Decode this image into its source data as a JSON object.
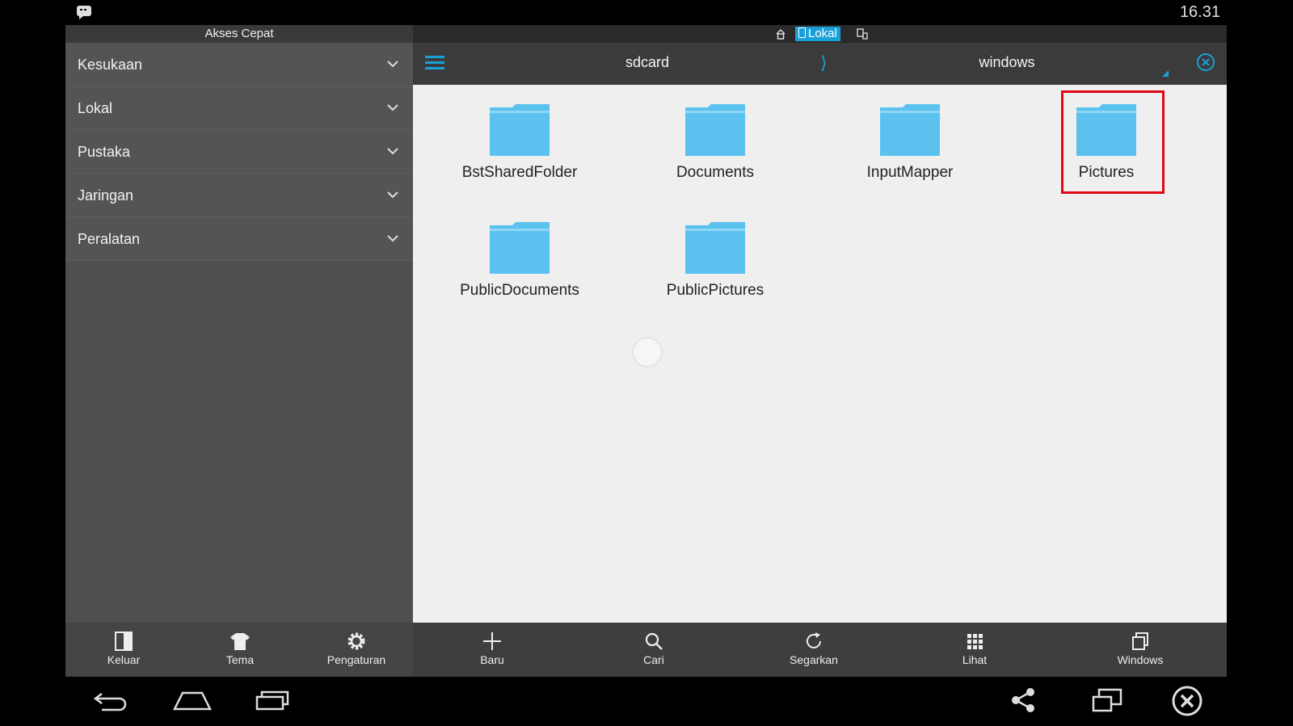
{
  "status_bar": {
    "time": "16.31",
    "notification_icon": "chat-notification-icon"
  },
  "drawer": {
    "title": "Akses Cepat",
    "items": [
      {
        "label": "Kesukaan"
      },
      {
        "label": "Lokal"
      },
      {
        "label": "Pustaka"
      },
      {
        "label": "Jaringan"
      },
      {
        "label": "Peralatan"
      }
    ],
    "footer": [
      {
        "label": "Keluar",
        "icon": "exit-icon"
      },
      {
        "label": "Tema",
        "icon": "shirt-icon"
      },
      {
        "label": "Pengaturan",
        "icon": "gear-icon"
      }
    ]
  },
  "location_bar": {
    "active_tab": "Lokal"
  },
  "path": {
    "crumbs": [
      "sdcard",
      "windows"
    ],
    "separator": "⟩"
  },
  "folders": [
    {
      "name": "BstSharedFolder"
    },
    {
      "name": "Documents"
    },
    {
      "name": "InputMapper"
    },
    {
      "name": "Pictures"
    },
    {
      "name": "PublicDocuments"
    },
    {
      "name": "PublicPictures"
    }
  ],
  "toolbar": [
    {
      "label": "Baru",
      "icon": "plus-icon"
    },
    {
      "label": "Cari",
      "icon": "search-icon"
    },
    {
      "label": "Segarkan",
      "icon": "refresh-icon"
    },
    {
      "label": "Lihat",
      "icon": "grid-view-icon"
    },
    {
      "label": "Windows",
      "icon": "windows-stack-icon"
    }
  ],
  "colors": {
    "accent": "#1aa0d8",
    "folder": "#5bc2f0",
    "highlight": "#e30613"
  }
}
